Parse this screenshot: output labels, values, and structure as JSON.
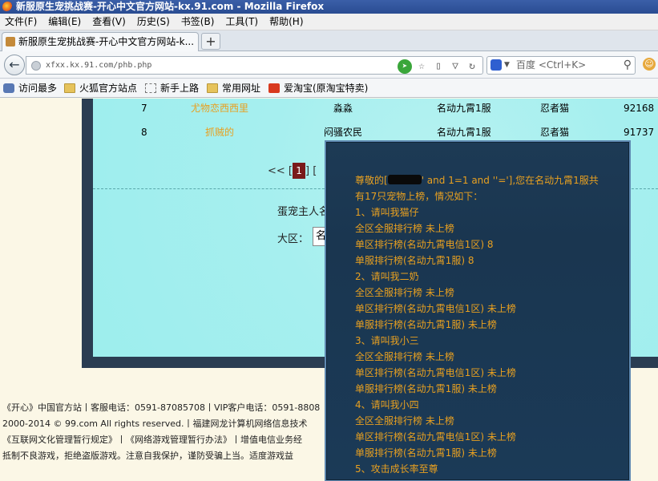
{
  "window": {
    "title": "新服原生宠挑战赛-开心中文官方网站-kx.91.com - Mozilla Firefox"
  },
  "menu": [
    "文件(F)",
    "编辑(E)",
    "查看(V)",
    "历史(S)",
    "书签(B)",
    "工具(T)",
    "帮助(H)"
  ],
  "tab": {
    "label": "新服原生宠挑战赛-开心中文官方网站-k...",
    "new_tab": "+"
  },
  "nav": {
    "url": "xfxx.kx.91.com/phb.php",
    "search_placeholder": "百度 <Ctrl+K>"
  },
  "bookmarks": [
    "访问最多",
    "火狐官方站点",
    "新手上路",
    "常用网址",
    "爱淘宝(原淘宝特卖)"
  ],
  "ranking": {
    "rows": [
      {
        "rank": "7",
        "pet": "尤物恋西西里",
        "owner": "淼淼",
        "server": "名动九霄1服",
        "type": "忍者猫",
        "score": "92168"
      },
      {
        "rank": "8",
        "pet": "抓贼的",
        "owner": "闷骚农民",
        "server": "名动九霄1服",
        "type": "忍者猫",
        "score": "91737"
      }
    ],
    "pager_prev": "<<",
    "pager_current": "1",
    "owner_label": "蛋宠主人名",
    "region_label": "大区：",
    "region_value": "名"
  },
  "footer": [
    "《开心》中国官方站丨客服电话：0591-87085708丨VIP客户电话：0591-8808",
    "2000-2014 © 99.com All rights reserved.丨福建网龙计算机网络信息技术",
    "《互联网文化管理暂行规定》丨《网络游戏管理暂行办法》丨增值电信业务经",
    "抵制不良游戏，拒绝盗版游戏。注意自我保护，谨防受骗上当。适度游戏益"
  ],
  "popup": {
    "greeting_prefix": "尊敬的[",
    "greeting_suffix": "' and 1=1 and ''='],您在名动九霄1服共",
    "lines": [
      "有17只宠物上榜，情况如下：",
      "1、请叫我猫仔",
      "全区全服排行榜 未上榜",
      "单区排行榜(名动九霄电信1区) 8",
      "单服排行榜(名动九霄1服) 8",
      "2、请叫我二奶",
      "全区全服排行榜 未上榜",
      "单区排行榜(名动九霄电信1区) 未上榜",
      "单服排行榜(名动九霄1服) 未上榜",
      "3、请叫我小三",
      "全区全服排行榜 未上榜",
      "单区排行榜(名动九霄电信1区) 未上榜",
      "单服排行榜(名动九霄1服) 未上榜",
      "4、请叫我小四",
      "全区全服排行榜 未上榜",
      "单区排行榜(名动九霄电信1区) 未上榜",
      "单服排行榜(名动九霄1服) 未上榜",
      "5、攻击成长率至尊"
    ]
  },
  "colors": {
    "title_bar": "#2a4c92",
    "popup_bg": "#1b3a57",
    "popup_text": "#e8a020",
    "game_bg": "#a6efef"
  }
}
